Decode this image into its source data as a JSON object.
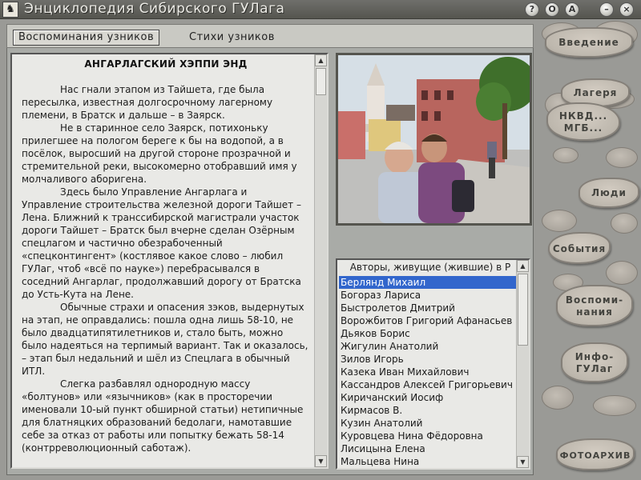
{
  "window": {
    "title": "Энциклопедия Сибирского ГУЛага",
    "controls": [
      "?",
      "О",
      "А",
      "–",
      "×"
    ]
  },
  "tabs": [
    {
      "label": "Воспоминания  узников",
      "active": true
    },
    {
      "label": "Стихи  узников",
      "active": false
    }
  ],
  "article": {
    "title": "АНГАРЛАГСКИЙ ХЭППИ ЭНД",
    "paragraphs": [
      "Нас гнали этапом из Тайшета, где была пересылка, известная долгосрочному лагерному племени, в Братск и дальше – в Заярск.",
      "Не в старинное село Заярск, потихоньку прилегшее на пологом береге к бы на водопой, а в посёлок, выросший на другой стороне прозрачной и стремительной реки, высокомерно отобравший имя у молчаливого аборигена.",
      "Здесь было Управление Ангарлага и Управление строительства железной дороги Тайшет – Лена. Ближний к транссибирской магистрали участок дороги Тайшет – Братск был вчерне сделан Озёрным спецлагом и частично обезрабоченный «спецконтингент» (костлявое какое слово – любил ГУЛаг, чтоб «всё по науке») перебрасывался в соседний Ангарлаг, продолжавший дорогу от Братска до Усть-Кута на Лене.",
      "Обычные страхи и опасения зэков, выдернутых на этап, не оправдались: пошла одна лишь 58-10, не было двадцатипятилетников и, стало быть, можно было надеяться на терпимый вариант. Так и оказалось, – этап был недальний и шёл из Спецлага в обычный ИТЛ.",
      "Слегка разбавлял однородную массу «болтунов» или «язычников» (как в просторечии именовали 10-ый пункт обширной статьи) нетипичные для блатняцких образований бедолаги, намотавшие себе за отказ от работы или попытку бежать 58-14 (контрреволюционный саботаж)."
    ]
  },
  "authors": {
    "header": "Авторы, живущие (жившие) в Р",
    "items": [
      "Берлянд Михаил",
      "Богораз Лариса",
      "Быстролетов Дмитрий",
      "Ворожбитов Григорий Афанасьев",
      "Дьяков Борис",
      "Жигулин Анатолий",
      "Зилов Игорь",
      "Казека Иван Михайлович",
      "Кассандров Алексей Григорьевич",
      "Киричанский Иосиф",
      "Кирмасов В.",
      "Кузин Анатолий",
      "Куровцева Нина Фёдоровна",
      "Лисицына Елена",
      "Мальцева Нина"
    ],
    "selected_index": 0
  },
  "nav": {
    "intro": "Введение",
    "camps": "Лагеря",
    "nkvd_line1": "НКВД...",
    "nkvd_line2": "МГБ...",
    "people": "Люди",
    "events": "События",
    "memoirs_line1": "Воспоми-",
    "memoirs_line2": "нания",
    "info_line1": "Инфо-",
    "info_line2": "ГУЛаг",
    "photo_archive": "ФОТОАРХИВ"
  },
  "colors": {
    "selection": "#3266cc",
    "panel_bg": "#e9e9e6",
    "stone": "#bdb7ad"
  }
}
